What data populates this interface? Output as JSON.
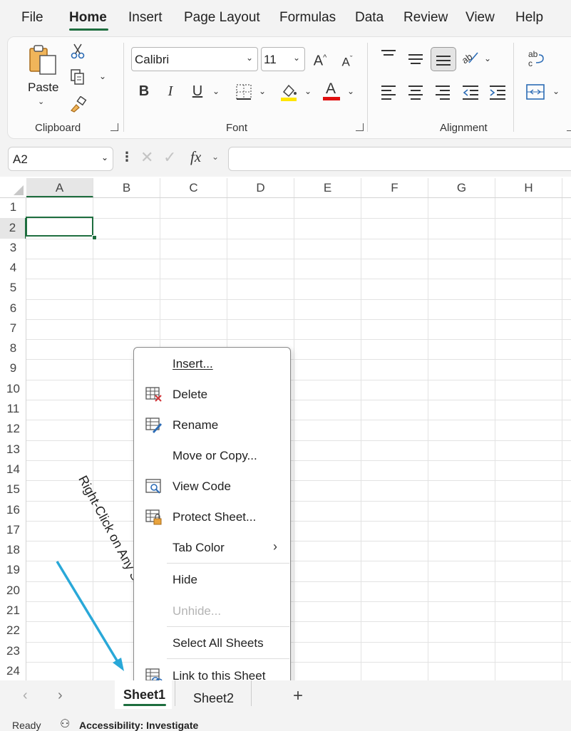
{
  "menubar": {
    "items": [
      "File",
      "Home",
      "Insert",
      "Page Layout",
      "Formulas",
      "Data",
      "Review",
      "View",
      "Help"
    ],
    "active": "Home"
  },
  "ribbon": {
    "clipboard": {
      "paste_label": "Paste",
      "group_label": "Clipboard"
    },
    "font": {
      "font_name": "Calibri",
      "font_size": "11",
      "group_label": "Font",
      "bold": "B",
      "italic": "I",
      "underline": "U",
      "highlight_color": "#ffe600",
      "font_color": "#e01010"
    },
    "alignment": {
      "group_label": "Alignment"
    }
  },
  "formula_bar": {
    "name_box": "A2",
    "fx": "fx",
    "value": ""
  },
  "grid": {
    "columns": [
      "A",
      "B",
      "C",
      "D",
      "E",
      "F",
      "G",
      "H"
    ],
    "rows": [
      "1",
      "2",
      "3",
      "4",
      "5",
      "6",
      "7",
      "8",
      "9",
      "10",
      "11",
      "12",
      "13",
      "14",
      "15",
      "16",
      "17",
      "18",
      "19",
      "20",
      "21",
      "22",
      "23",
      "24"
    ],
    "selected_cell": "A2"
  },
  "context_menu": {
    "items": [
      {
        "label": "Insert...",
        "icon": "none",
        "disabled": false
      },
      {
        "label": "Delete",
        "icon": "delete-sheet-icon",
        "disabled": false
      },
      {
        "label": "Rename",
        "icon": "rename-sheet-icon",
        "disabled": false
      },
      {
        "label": "Move or Copy...",
        "icon": "none",
        "disabled": false
      },
      {
        "label": "View Code",
        "icon": "view-code-icon",
        "disabled": false
      },
      {
        "label": "Protect Sheet...",
        "icon": "protect-sheet-icon",
        "disabled": false
      },
      {
        "label": "Tab Color",
        "icon": "none",
        "disabled": false,
        "submenu": true
      },
      {
        "label": "Hide",
        "icon": "none",
        "disabled": false
      },
      {
        "label": "Unhide...",
        "icon": "none",
        "disabled": true
      },
      {
        "label": "Select All Sheets",
        "icon": "none",
        "disabled": false
      },
      {
        "label": "Link to this Sheet",
        "icon": "link-sheet-icon",
        "disabled": false
      }
    ]
  },
  "annotation": {
    "text": "Right-Click on Any Sheet Tab",
    "color": "#29a8d8"
  },
  "sheet_tabs": {
    "tabs": [
      "Sheet1",
      "Sheet2"
    ],
    "active": "Sheet1",
    "add_label": "+"
  },
  "status_bar": {
    "ready": "Ready",
    "accessibility": "Accessibility: Investigate"
  },
  "colors": {
    "accent": "#1e6e3f",
    "selection_border": "#1e6e3f"
  }
}
